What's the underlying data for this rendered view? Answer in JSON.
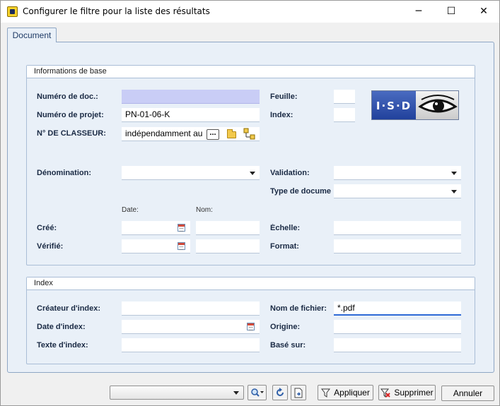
{
  "window": {
    "title": "Configurer le filtre pour la liste des résultats",
    "controls": {
      "minimize": "─",
      "maximize": "☐",
      "close": "✕"
    }
  },
  "tabs": [
    {
      "label": "Document",
      "active": true
    }
  ],
  "groups": {
    "basic": {
      "title": "Informations de base",
      "labels": {
        "doc_number": "Numéro de doc.:",
        "project_number": "Numéro de projet:",
        "binder": "N° DE CLASSEUR:",
        "sheet": "Feuille:",
        "index": "Index:",
        "denomination": "Dénomination:",
        "validation": "Validation:",
        "doc_type": "Type de docume",
        "date_header": "Date:",
        "name_header": "Nom:",
        "created": "Créé:",
        "verified": "Vérifié:",
        "scale": "Échelle:",
        "format": "Format:"
      },
      "values": {
        "doc_number": "",
        "project_number": "PN-01-06-K",
        "binder": "indépendamment au",
        "sheet": "",
        "index": "",
        "denomination": "",
        "validation": "",
        "doc_type": "",
        "created_date": "",
        "created_name": "",
        "verified_date": "",
        "verified_name": "",
        "scale": "",
        "format": ""
      },
      "binder_browse_label": "...",
      "logo_text": "I·S·D"
    },
    "index": {
      "title": "Index",
      "labels": {
        "creator": "Créateur d'index:",
        "date": "Date d'index:",
        "text": "Texte d'index:",
        "filename": "Nom de fichier:",
        "origin": "Origine:",
        "based_on": "Basé sur:"
      },
      "values": {
        "creator": "",
        "date": "",
        "text": "",
        "filename": "*.pdf",
        "origin": "",
        "based_on": ""
      }
    }
  },
  "footer": {
    "filter_combo_value": "",
    "apply": "Appliquer",
    "delete": "Supprimer",
    "cancel": "Annuler"
  },
  "colors": {
    "panel_bg": "#e9f0f8",
    "required_field": "#c9cdf6",
    "focus_underline": "#2e6ad6",
    "label_text": "#1a2a44"
  }
}
